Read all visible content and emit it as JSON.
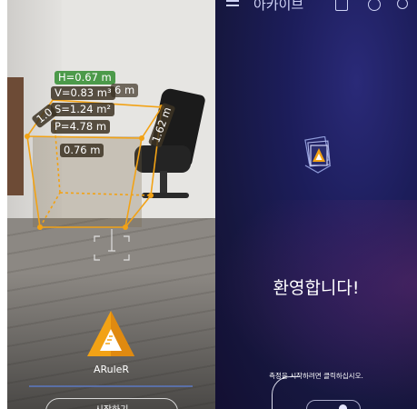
{
  "ar": {
    "measurements": {
      "height": "H=0.67 m",
      "volume": "V=0.83 m³",
      "surface": "S=1.24 m²",
      "perimeter": "P=4.78 m",
      "edge_front": "0.76 m",
      "edge_top_right": "6 m",
      "edge_left": "1.0",
      "edge_right": "1.62 m"
    },
    "app_name": "ARuleR",
    "start_button": "시작하기"
  },
  "app": {
    "header_title": "아카이브",
    "welcome": "환영합니다!",
    "hint": "측정을 시작하려면 클릭하십시오."
  },
  "colors": {
    "accent_orange": "#f2a215",
    "app_bg": "#1c1d5a",
    "label_green": "#4c9a4a"
  }
}
